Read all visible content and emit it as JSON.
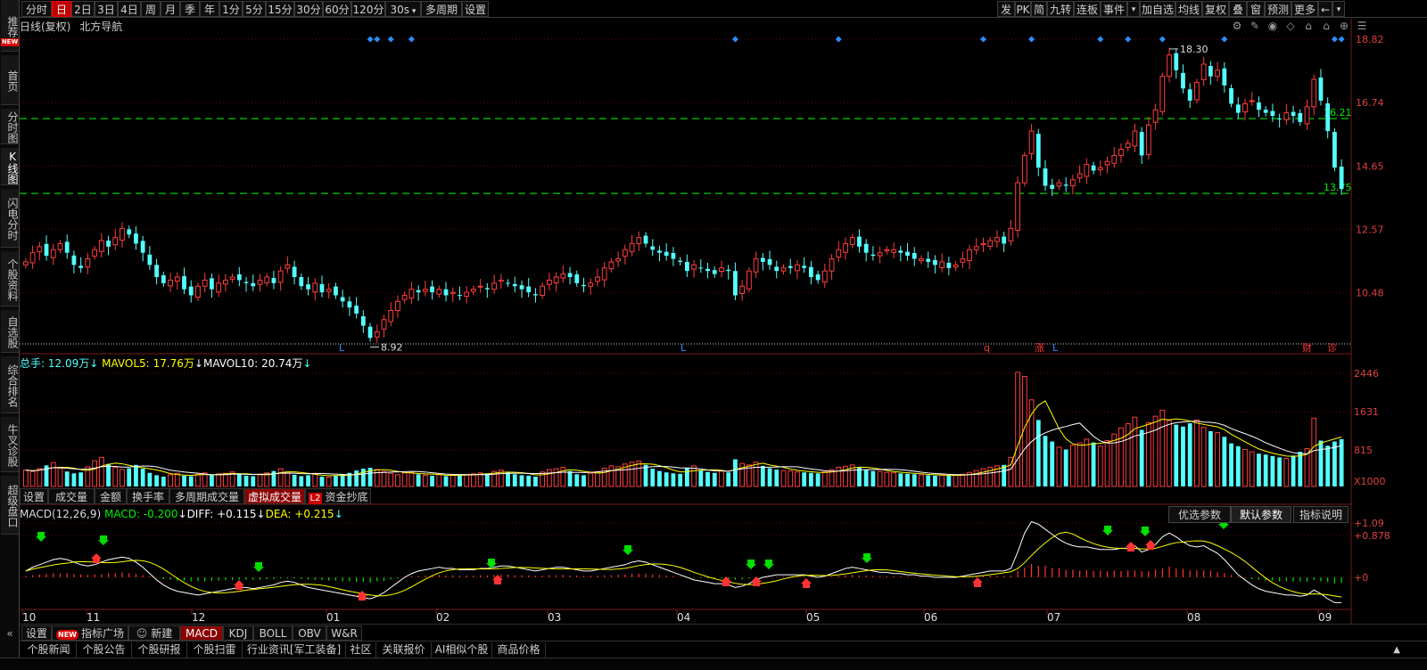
{
  "left_nav": [
    {
      "label": "推荐",
      "badge": "NEW"
    },
    {
      "label": "首页"
    },
    {
      "label": "分时图"
    },
    {
      "label": "K线图",
      "active": true
    },
    {
      "label": "闪电分时"
    },
    {
      "label": "个股资料"
    },
    {
      "label": "自选股"
    },
    {
      "label": "综合排名"
    },
    {
      "label": "牛叉诊股"
    },
    {
      "label": "超级盘口"
    }
  ],
  "toolbar_left": [
    "分时",
    "日",
    "2日",
    "3日",
    "4日",
    "周",
    "月",
    "季",
    "年",
    "1分",
    "5分",
    "15分",
    "30分",
    "60分",
    "120分",
    "30s",
    "多周期",
    "设置"
  ],
  "toolbar_left_active": "日",
  "toolbar_right": [
    "发",
    "PK",
    "简",
    "九转",
    "连板",
    "事件",
    "加自选",
    "均线",
    "复权",
    "叠",
    "窗",
    "预测",
    "更多"
  ],
  "header": {
    "period": "日线(复权)",
    "name": "北方导航",
    "icons": [
      "gear-icon",
      "pen-icon",
      "eye-icon",
      "diamond-icon",
      "lock-icon",
      "lock-icon",
      "add-circle-icon",
      "menu-icon"
    ]
  },
  "price_axis": [
    "18.82",
    "16.74",
    "14.65",
    "12.57",
    "10.48"
  ],
  "price_labels": {
    "high": "18.30",
    "low": "8.92",
    "line_upper": "16.21",
    "line_lower": "13.75"
  },
  "event_markers": [
    "L",
    "L",
    "q",
    "涨",
    "L",
    "财",
    "诊"
  ],
  "volume_info": {
    "total_label": "总手:",
    "total_value": "12.09万",
    "mavol5_label": "MAVOL5:",
    "mavol5_value": "17.76万",
    "mavol10_label": "MAVOL10:",
    "mavol10_value": "20.74万"
  },
  "volume_axis": [
    "2446",
    "1631",
    "815",
    "X1000"
  ],
  "volume_tabs": [
    "设置",
    "成交量",
    "金额",
    "换手率",
    "多周期成交量",
    "虚拟成交量",
    "资金抄底"
  ],
  "volume_tabs_active": "虚拟成交量",
  "l2_badge": "L2",
  "macd_info": {
    "title": "MACD(12,26,9)",
    "macd_label": "MACD:",
    "macd_value": "-0.200",
    "diff_label": "DIFF:",
    "diff_value": "+0.115",
    "dea_label": "DEA:",
    "dea_value": "+0.215"
  },
  "macd_axis": [
    "+1.09",
    "+0.878",
    "+0"
  ],
  "param_buttons": [
    "优选参数",
    "默认参数",
    "指标说明"
  ],
  "param_active": "默认参数",
  "month_labels": [
    "10",
    "11",
    "12",
    "01",
    "02",
    "03",
    "04",
    "05",
    "06",
    "07",
    "08",
    "09"
  ],
  "indicator_tabs": [
    "设置",
    "指标广场",
    "新建",
    "MACD",
    "KDJ",
    "BOLL",
    "OBV",
    "W&R"
  ],
  "indicator_active": "MACD",
  "new_pill": "NEW",
  "info_tabs": [
    "个股新闻",
    "个股公告",
    "个股研报",
    "个股扫雷",
    "行业资讯[军工装备]",
    "社区",
    "关联报价",
    "AI相似个股",
    "商品价格"
  ],
  "colors": {
    "up": "#ff3d3d",
    "down": "#54ffff",
    "ma5": "#ffffff",
    "ma10": "#ffff00",
    "dashed_line": "#00cc00",
    "axis_text": "#e04040",
    "signal_buy": "#ff3333",
    "signal_sell": "#00dd00",
    "diamond": "#2a8fff"
  },
  "chart_data": {
    "type": "candlestick",
    "series": [
      {
        "name": "价格",
        "values": [
          11.5,
          11.8,
          12.0,
          11.7,
          11.9,
          12.1,
          11.8,
          11.4,
          11.3,
          11.6,
          11.9,
          12.2,
          12.0,
          12.3,
          12.6,
          12.4,
          12.1,
          11.8,
          11.4,
          11.0,
          10.8,
          10.9,
          11.0,
          10.6,
          10.4,
          10.7,
          10.9,
          10.6,
          10.8,
          10.9,
          11.0,
          10.9,
          10.8,
          10.7,
          10.9,
          11.0,
          10.8,
          11.2,
          11.4,
          11.0,
          10.7,
          10.6,
          10.8,
          10.5,
          10.6,
          10.4,
          10.2,
          10.0,
          9.8,
          9.4,
          9.0,
          9.2,
          9.6,
          9.9,
          10.2,
          10.4,
          10.6,
          10.5,
          10.6,
          10.5,
          10.6,
          10.4,
          10.5,
          10.4,
          10.5,
          10.6,
          10.7,
          10.6,
          10.8,
          10.9,
          10.8,
          10.7,
          10.6,
          10.5,
          10.4,
          10.7,
          10.9,
          11.0,
          11.1,
          11.0,
          10.8,
          10.7,
          10.8,
          11.0,
          11.3,
          11.5,
          11.6,
          11.9,
          12.1,
          12.3,
          12.1,
          11.9,
          11.8,
          11.7,
          11.6,
          11.5,
          11.2,
          11.4,
          11.3,
          11.2,
          11.1,
          11.3,
          11.2,
          10.4,
          10.7,
          11.2,
          11.6,
          11.5,
          11.4,
          11.2,
          11.3,
          11.3,
          11.4,
          11.3,
          11.0,
          10.9,
          11.2,
          11.6,
          11.9,
          12.1,
          12.3,
          12.0,
          11.8,
          11.7,
          11.8,
          11.9,
          11.9,
          11.8,
          11.7,
          11.6,
          11.6,
          11.5,
          11.4,
          11.5,
          11.3,
          11.4,
          11.6,
          11.9,
          12.0,
          12.1,
          12.2,
          12.3,
          12.1,
          12.6,
          14.1,
          15.0,
          15.8,
          14.6,
          14.0,
          13.9,
          14.1,
          14.0,
          14.2,
          14.4,
          14.7,
          14.5,
          14.6,
          14.8,
          15.0,
          15.2,
          15.4,
          15.8,
          15.0,
          16.0,
          16.5,
          17.6,
          18.3,
          17.8,
          17.2,
          16.8,
          17.4,
          18.0,
          17.6,
          17.8,
          17.3,
          16.7,
          16.4,
          16.7,
          16.8,
          16.5,
          16.4,
          16.3,
          16.2,
          16.4,
          16.3,
          16.1,
          16.6,
          17.5,
          16.8,
          15.8,
          14.6,
          13.9
        ]
      },
      {
        "name": "成交量",
        "values": [
          3.5,
          3.2,
          3.8,
          4.5,
          5.1,
          3.9,
          3.2,
          2.8,
          3.0,
          4.2,
          5.5,
          6.2,
          4.8,
          4.1,
          3.6,
          3.9,
          4.6,
          3.8,
          2.9,
          2.4,
          2.1,
          2.5,
          2.8,
          2.3,
          2.2,
          2.6,
          2.9,
          2.4,
          2.7,
          2.8,
          3.1,
          2.6,
          2.3,
          2.2,
          2.5,
          2.9,
          3.3,
          3.8,
          3.1,
          2.5,
          2.2,
          2.4,
          2.8,
          2.1,
          2.0,
          2.3,
          2.6,
          2.9,
          3.4,
          3.8,
          4.0,
          3.6,
          3.2,
          2.8,
          2.5,
          2.9,
          3.0,
          2.6,
          2.4,
          2.3,
          2.5,
          2.2,
          2.4,
          2.6,
          2.5,
          2.7,
          2.9,
          2.8,
          3.2,
          3.5,
          3.0,
          2.6,
          2.4,
          2.3,
          2.1,
          3.1,
          3.6,
          3.8,
          4.1,
          3.3,
          2.6,
          2.4,
          2.8,
          3.2,
          3.9,
          4.4,
          4.2,
          4.8,
          5.2,
          5.4,
          4.6,
          3.8,
          3.3,
          3.0,
          2.8,
          2.7,
          3.9,
          4.4,
          3.5,
          3.1,
          2.9,
          3.4,
          3.0,
          5.8,
          4.9,
          4.6,
          5.2,
          4.4,
          3.9,
          3.6,
          3.4,
          3.3,
          3.1,
          3.0,
          2.9,
          2.8,
          3.1,
          3.6,
          4.1,
          4.3,
          4.6,
          4.0,
          3.5,
          3.3,
          3.2,
          3.0,
          2.9,
          2.8,
          2.7,
          2.6,
          2.5,
          2.4,
          2.3,
          2.4,
          2.3,
          2.4,
          2.6,
          3.0,
          3.4,
          3.8,
          4.1,
          4.4,
          4.6,
          6.2,
          24.4,
          23.5,
          18.5,
          14.2,
          10.8,
          9.6,
          8.4,
          7.9,
          8.8,
          9.3,
          10.1,
          9.4,
          8.6,
          9.8,
          11.2,
          12.5,
          13.4,
          14.8,
          12.1,
          13.6,
          15.0,
          16.3,
          14.1,
          13.2,
          12.8,
          13.5,
          14.2,
          12.6,
          11.8,
          11.5,
          10.6,
          9.2,
          8.6,
          7.9,
          7.4,
          7.0,
          6.8,
          6.5,
          6.2,
          6.0,
          6.6,
          7.4,
          8.1,
          14.6,
          9.8,
          8.7,
          9.6,
          10.1
        ]
      },
      {
        "name": "MACD",
        "values": [
          0.05,
          0.08,
          0.1,
          0.12,
          0.14,
          0.15,
          0.14,
          0.12,
          0.1,
          0.09,
          0.1,
          0.12,
          0.14,
          0.15,
          0.16,
          0.15,
          0.12,
          0.08,
          0.03,
          -0.02,
          -0.06,
          -0.09,
          -0.11,
          -0.12,
          -0.13,
          -0.14,
          -0.13,
          -0.12,
          -0.11,
          -0.1,
          -0.09,
          -0.08,
          -0.08,
          -0.09,
          -0.08,
          -0.07,
          -0.06,
          -0.04,
          -0.03,
          -0.04,
          -0.06,
          -0.08,
          -0.09,
          -0.1,
          -0.11,
          -0.12,
          -0.13,
          -0.14,
          -0.15,
          -0.16,
          -0.17,
          -0.15,
          -0.12,
          -0.08,
          -0.04,
          0.0,
          0.03,
          0.05,
          0.06,
          0.07,
          0.08,
          0.07,
          0.07,
          0.06,
          0.06,
          0.06,
          0.07,
          0.07,
          0.08,
          0.09,
          0.09,
          0.08,
          0.07,
          0.06,
          0.05,
          0.06,
          0.07,
          0.08,
          0.08,
          0.07,
          0.06,
          0.05,
          0.05,
          0.06,
          0.07,
          0.08,
          0.09,
          0.1,
          0.12,
          0.13,
          0.12,
          0.1,
          0.08,
          0.06,
          0.04,
          0.02,
          0.0,
          -0.02,
          -0.03,
          -0.04,
          -0.05,
          -0.05,
          -0.06,
          -0.08,
          -0.07,
          -0.05,
          -0.02,
          0.0,
          0.01,
          0.02,
          0.02,
          0.02,
          0.02,
          0.02,
          0.01,
          0.0,
          0.01,
          0.03,
          0.05,
          0.07,
          0.08,
          0.07,
          0.06,
          0.05,
          0.04,
          0.04,
          0.03,
          0.03,
          0.02,
          0.02,
          0.01,
          0.01,
          0.0,
          0.0,
          0.0,
          0.0,
          0.01,
          0.02,
          0.03,
          0.04,
          0.05,
          0.05,
          0.05,
          0.07,
          0.2,
          0.35,
          0.44,
          0.42,
          0.38,
          0.34,
          0.3,
          0.27,
          0.25,
          0.24,
          0.24,
          0.23,
          0.22,
          0.22,
          0.22,
          0.23,
          0.23,
          0.25,
          0.2,
          0.22,
          0.26,
          0.32,
          0.35,
          0.32,
          0.28,
          0.25,
          0.24,
          0.25,
          0.22,
          0.19,
          0.14,
          0.08,
          0.02,
          -0.02,
          -0.06,
          -0.09,
          -0.11,
          -0.12,
          -0.13,
          -0.14,
          -0.14,
          -0.15,
          -0.14,
          -0.1,
          -0.13,
          -0.17,
          -0.2,
          -0.2
        ]
      }
    ],
    "y_ranges": {
      "price": [
        8.92,
        18.82
      ],
      "volume": [
        0,
        2446
      ],
      "macd": [
        -0.4,
        1.09
      ]
    }
  }
}
